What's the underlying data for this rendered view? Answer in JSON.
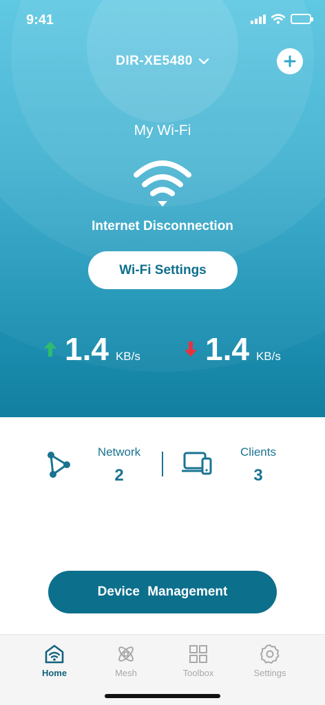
{
  "status_bar": {
    "time": "9:41"
  },
  "header": {
    "device_name": "DIR-XE5480",
    "add_icon": "plus-icon"
  },
  "wifi": {
    "name": "My Wi-Fi",
    "status": "Internet Disconnection",
    "settings_button": "Wi-Fi Settings"
  },
  "speed": {
    "upload": {
      "value": "1.4",
      "unit": "KB/s",
      "color": "#2dbd6e"
    },
    "download": {
      "value": "1.4",
      "unit": "KB/s",
      "color": "#e8323c"
    }
  },
  "stats": {
    "network": {
      "label": "Network",
      "value": "2",
      "icon": "network-icon"
    },
    "clients": {
      "label": "Clients",
      "value": "3",
      "icon": "devices-icon"
    }
  },
  "device_management_button": "Device Management",
  "tabs": [
    {
      "label": "Home",
      "icon": "home-wifi-icon",
      "active": true
    },
    {
      "label": "Mesh",
      "icon": "mesh-icon",
      "active": false
    },
    {
      "label": "Toolbox",
      "icon": "grid-icon",
      "active": false
    },
    {
      "label": "Settings",
      "icon": "gear-icon",
      "active": false
    }
  ],
  "colors": {
    "primary": "#0c6f8c",
    "text_accent": "#1a7391",
    "hero_top": "#4fc3e0",
    "hero_bottom": "#127f9f"
  }
}
